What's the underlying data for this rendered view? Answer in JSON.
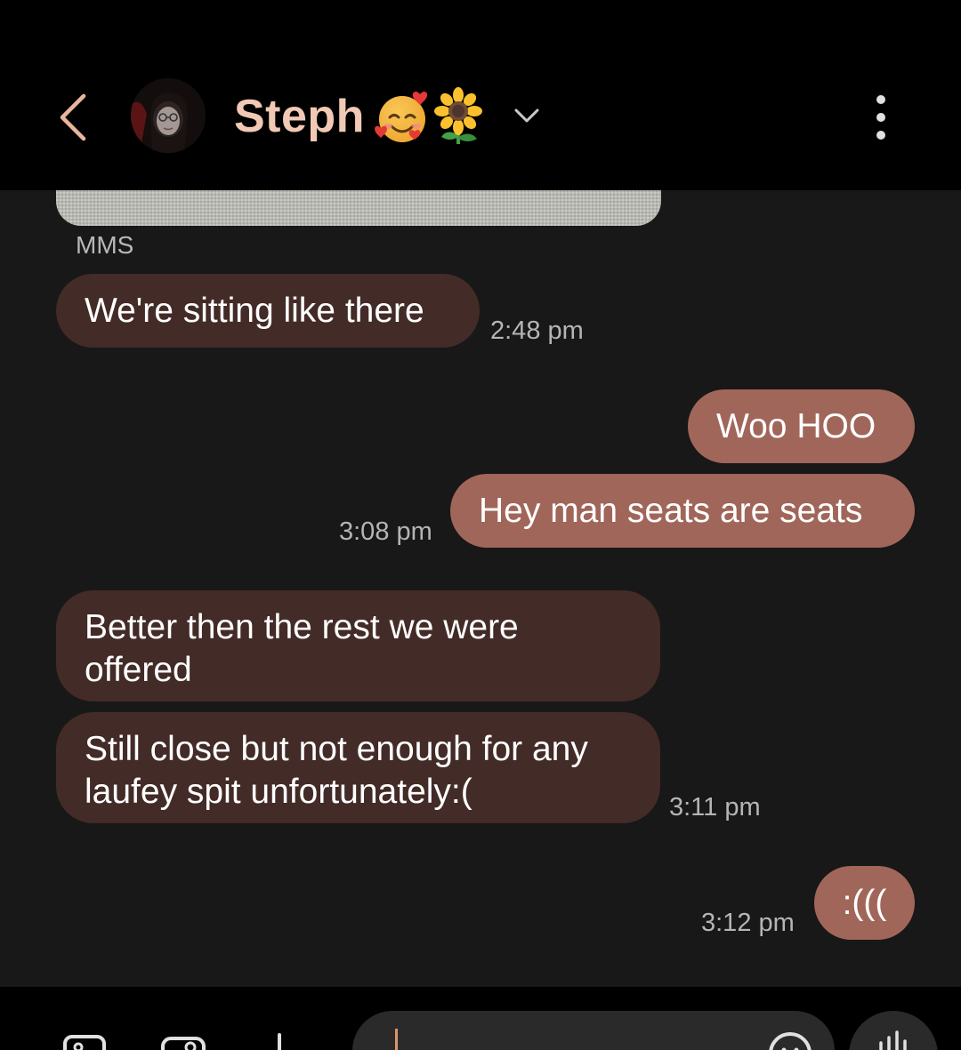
{
  "header": {
    "contact_name": "Steph",
    "name_emojis": [
      "smiling-face-with-hearts",
      "sunflower"
    ],
    "icons": {
      "back": "chevron-left-icon",
      "dropdown": "chevron-down-icon",
      "menu": "more-vertical-icon"
    }
  },
  "conversation": {
    "attachment_label": "MMS",
    "messages": [
      {
        "direction": "incoming",
        "text": "We're sitting like there",
        "time": "2:48 pm"
      },
      {
        "direction": "outgoing",
        "text": "Woo HOO",
        "time": ""
      },
      {
        "direction": "outgoing",
        "text": "Hey man seats are seats",
        "time": "3:08 pm"
      },
      {
        "direction": "incoming",
        "text": "Better then the rest we were offered",
        "time": ""
      },
      {
        "direction": "incoming",
        "text": "Still close but not enough for any laufey spit unfortunately:(",
        "time": "3:11 pm"
      },
      {
        "direction": "outgoing",
        "text": ":(((",
        "time": "3:12 pm"
      }
    ]
  },
  "composer": {
    "icons": [
      "gallery-icon",
      "camera-icon",
      "add-icon",
      "emoji-icon",
      "voice-input-icon"
    ],
    "input_value": ""
  },
  "colors": {
    "background": "#181818",
    "header_background": "#000000",
    "incoming_bubble": "#432b27",
    "outgoing_bubble": "#a1665a",
    "accent": "#f1c9b4",
    "timestamp": "#b5b5b5"
  }
}
